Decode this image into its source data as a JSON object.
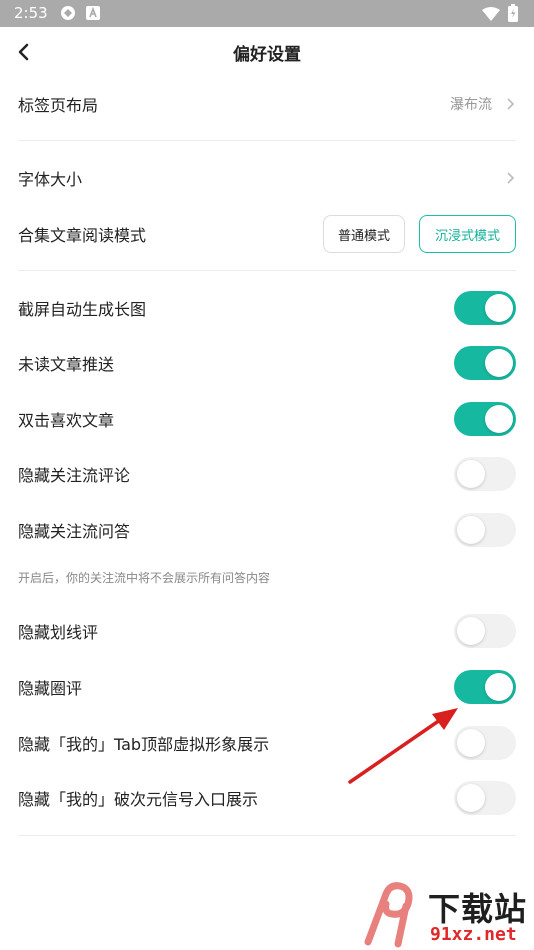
{
  "status_bar": {
    "time": "2:53"
  },
  "header": {
    "title": "偏好设置"
  },
  "rows": {
    "tab_layout": {
      "label": "标签页布局",
      "value": "瀑布流"
    },
    "font_size": {
      "label": "字体大小"
    },
    "collection_mode": {
      "label": "合集文章阅读模式",
      "options": [
        "普通模式",
        "沉浸式模式"
      ],
      "selected": "沉浸式模式"
    }
  },
  "toggles": [
    {
      "label": "截屏自动生成长图",
      "on": true
    },
    {
      "label": "未读文章推送",
      "on": true
    },
    {
      "label": "双击喜欢文章",
      "on": true
    },
    {
      "label": "隐藏关注流评论",
      "on": false
    },
    {
      "label": "隐藏关注流问答",
      "on": false
    },
    {
      "label": "隐藏划线评",
      "on": false
    },
    {
      "label": "隐藏圈评",
      "on": true
    },
    {
      "label": "隐藏「我的」Tab顶部虚拟形象展示",
      "on": false
    },
    {
      "label": "隐藏「我的」破次元信号入口展示",
      "on": false
    }
  ],
  "hint_text": "开启后，你的关注流中将不会展示所有问答内容",
  "watermark": {
    "brand": "下载站",
    "url": "91xz.net"
  },
  "colors": {
    "accent": "#17b8a0",
    "toggle_off": "#f1f1f1",
    "annotation_arrow": "#d8201f"
  }
}
